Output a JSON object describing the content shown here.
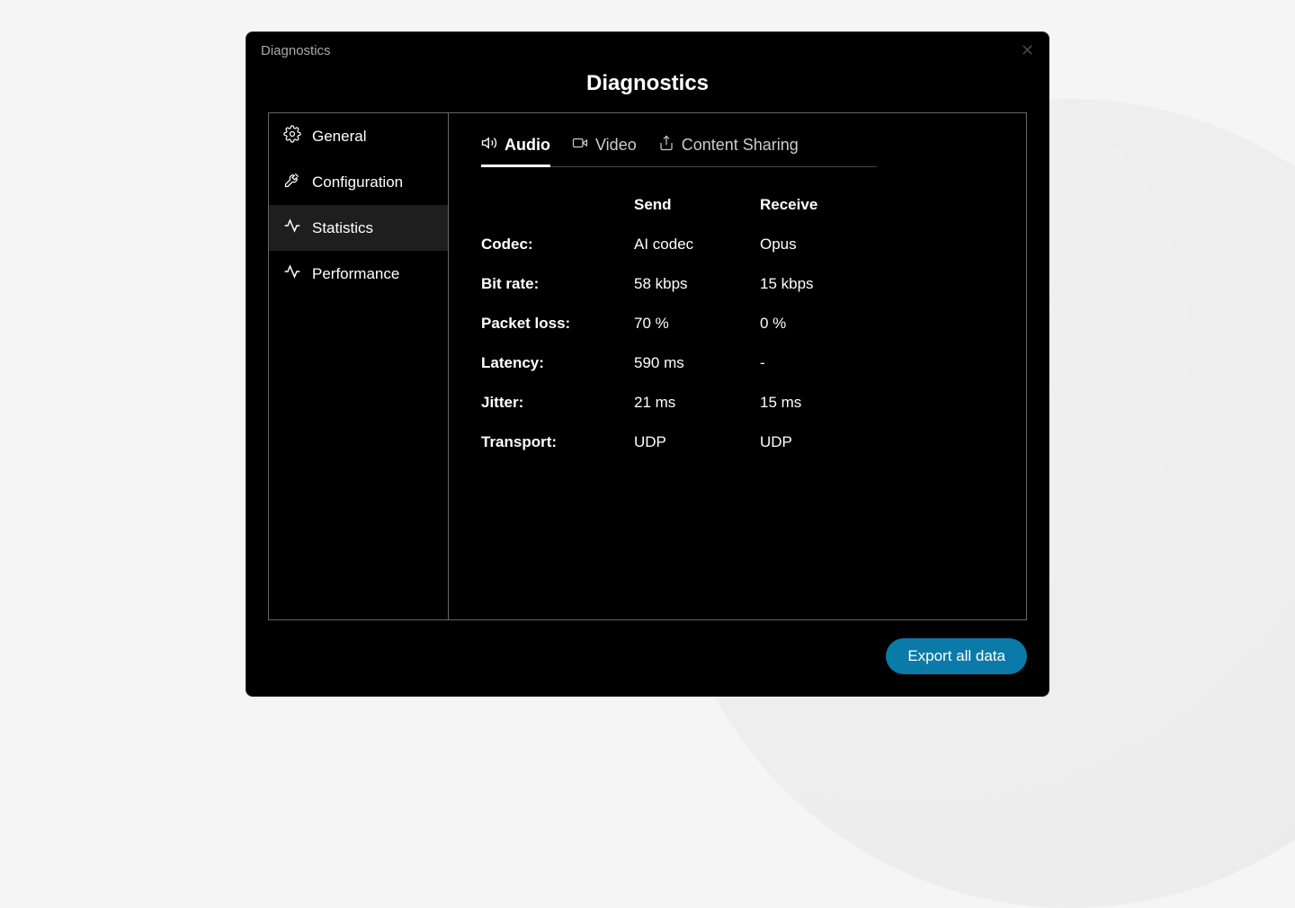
{
  "titlebar": {
    "label": "Diagnostics"
  },
  "dialog_title": "Diagnostics",
  "sidebar": {
    "items": [
      {
        "label": "General"
      },
      {
        "label": "Configuration"
      },
      {
        "label": "Statistics"
      },
      {
        "label": "Performance"
      }
    ]
  },
  "tabs": [
    {
      "label": "Audio"
    },
    {
      "label": "Video"
    },
    {
      "label": "Content Sharing"
    }
  ],
  "table": {
    "headers": {
      "send": "Send",
      "receive": "Receive"
    },
    "rows": [
      {
        "label": "Codec:",
        "send": "AI codec",
        "receive": "Opus"
      },
      {
        "label": "Bit rate:",
        "send": "58 kbps",
        "receive": "15 kbps"
      },
      {
        "label": "Packet loss:",
        "send": "70 %",
        "receive": "0 %"
      },
      {
        "label": "Latency:",
        "send": "590 ms",
        "receive": "-"
      },
      {
        "label": "Jitter:",
        "send": "21 ms",
        "receive": "15 ms"
      },
      {
        "label": "Transport:",
        "send": "UDP",
        "receive": "UDP"
      }
    ]
  },
  "footer": {
    "export_label": "Export all data"
  }
}
